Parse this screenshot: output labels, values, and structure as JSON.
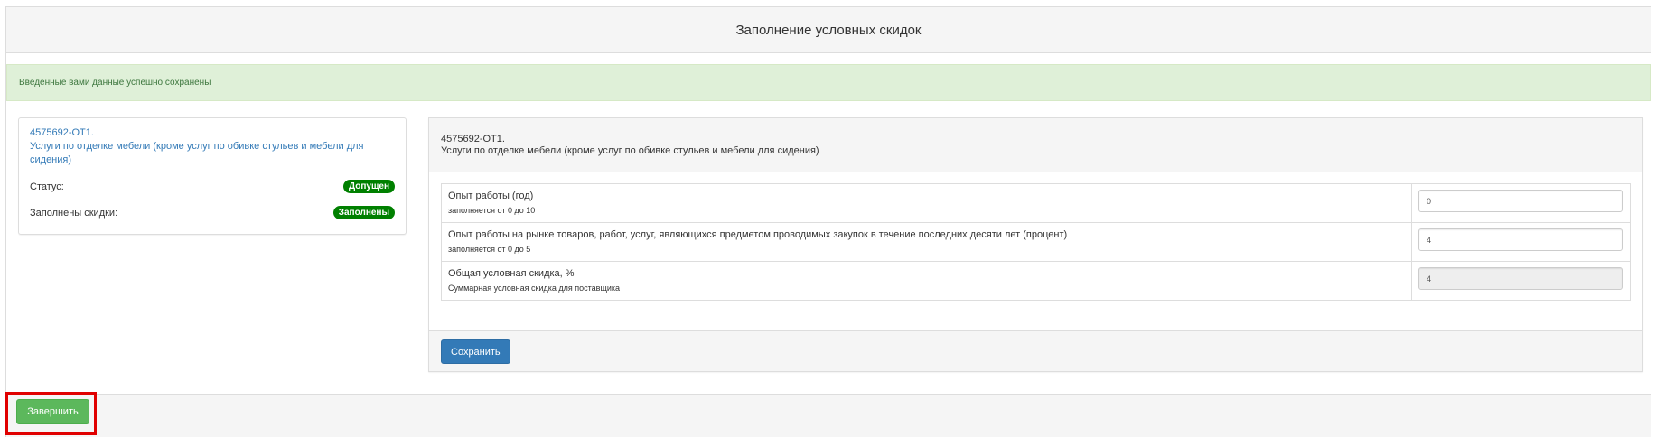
{
  "page": {
    "title": "Заполнение условных скидок",
    "success_message": "Введенные вами данные успешно сохранены"
  },
  "lot_card": {
    "code": "4575692-ОТ1.",
    "name": "Услуги по отделке мебели (кроме услуг по обивке стульев и мебели для сидения)",
    "status_label": "Статус:",
    "status_value": "Допущен",
    "discounts_label": "Заполнены скидки:",
    "discounts_value": "Заполнены",
    "badge_color": "#008000"
  },
  "detail": {
    "code": "4575692-ОТ1.",
    "name": "Услуги по отделке мебели (кроме услуг по обивке стульев и мебели для сидения)",
    "rows": [
      {
        "title": "Опыт работы (год)",
        "hint": "заполняется от 0 до 10",
        "value": "0",
        "readonly": false
      },
      {
        "title": "Опыт работы на рынке товаров, работ, услуг, являющихся предметом проводимых закупок в течение последних десяти лет (процент)",
        "hint": "заполняется от 0 до 5",
        "value": "4",
        "readonly": false
      },
      {
        "title": "Общая условная скидка, %",
        "hint": "Суммарная условная скидка для поставщика",
        "value": "4",
        "readonly": true
      }
    ],
    "save_label": "Сохранить"
  },
  "footer": {
    "finish_label": "Завершить"
  },
  "colors": {
    "primary": "#337ab7",
    "success": "#5cb85c",
    "alert_bg": "#dff0d8",
    "highlight": "#e00000"
  }
}
